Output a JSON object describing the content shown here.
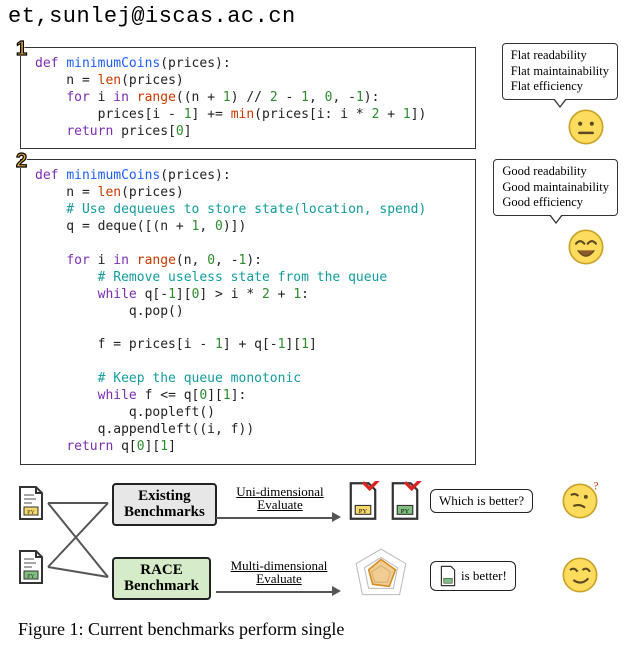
{
  "header": "et,sunlej@iscas.ac.cn",
  "panel1": {
    "badge": "1",
    "line1_def": "def ",
    "line1_fn": "minimumCoins",
    "line1_rest": "(prices):",
    "line2_a": "    n = ",
    "line2_b": "len",
    "line2_c": "(prices)",
    "line3_a": "    ",
    "line3_for": "for ",
    "line3_b": "i ",
    "line3_in": "in ",
    "line3_rng": "range",
    "line3_c": "((n + ",
    "line3_n1": "1",
    "line3_d": ") // ",
    "line3_n2": "2",
    "line3_e": " - ",
    "line3_n3": "1",
    "line3_f": ", ",
    "line3_n4": "0",
    "line3_g": ", -",
    "line3_n5": "1",
    "line3_h": "):",
    "line4_a": "        prices[i - ",
    "line4_n1": "1",
    "line4_b": "] += ",
    "line4_min": "min",
    "line4_c": "(prices[i: i * ",
    "line4_n2": "2",
    "line4_d": " + ",
    "line4_n3": "1",
    "line4_e": "])",
    "line5_a": "    ",
    "line5_ret": "return ",
    "line5_b": "prices[",
    "line5_n": "0",
    "line5_c": "]"
  },
  "bubble1": {
    "l1": "Flat readability",
    "l2": "Flat maintainability",
    "l3": "Flat efficiency"
  },
  "panel2": {
    "badge": "2",
    "l1_def": "def ",
    "l1_fn": "minimumCoins",
    "l1_rest": "(prices):",
    "l2a": "    n = ",
    "l2b": "len",
    "l2c": "(prices)",
    "l3": "    # Use dequeues to store state(location, spend)",
    "l4a": "    q = deque([(n + ",
    "l4n1": "1",
    "l4b": ", ",
    "l4n2": "0",
    "l4c": ")])",
    "blank1": " ",
    "l5a": "    ",
    "l5for": "for ",
    "l5b": "i ",
    "l5in": "in ",
    "l5rng": "range",
    "l5c": "(n, ",
    "l5n1": "0",
    "l5d": ", -",
    "l5n2": "1",
    "l5e": "):",
    "l6": "        # Remove useless state from the queue",
    "l7a": "        ",
    "l7w": "while ",
    "l7b": "q[-",
    "l7n1": "1",
    "l7c": "][",
    "l7n2": "0",
    "l7d": "] > i * ",
    "l7n3": "2",
    "l7e": " + ",
    "l7n4": "1",
    "l7f": ":",
    "l8": "            q.pop()",
    "blank2": " ",
    "l9a": "        f = prices[i - ",
    "l9n1": "1",
    "l9b": "] + q[-",
    "l9n2": "1",
    "l9c": "][",
    "l9n3": "1",
    "l9d": "]",
    "blank3": " ",
    "l10": "        # Keep the queue monotonic",
    "l11a": "        ",
    "l11w": "while ",
    "l11b": "f <= q[",
    "l11n1": "0",
    "l11c": "][",
    "l11n2": "1",
    "l11d": "]:",
    "l12": "            q.popleft()",
    "l13": "        q.appendleft((i, f))",
    "l14a": "    ",
    "l14ret": "return ",
    "l14b": "q[",
    "l14n1": "0",
    "l14c": "][",
    "l14n2": "1",
    "l14d": "]"
  },
  "bubble2": {
    "l1": "Good readability",
    "l2": "Good maintainability",
    "l3": "Good efficiency"
  },
  "diagram": {
    "existing_l1": "Existing",
    "existing_l2": "Benchmarks",
    "race_l1": "RACE",
    "race_l2": "Benchmark",
    "uni_l1": "Uni-dimensional",
    "uni_l2": "Evaluate",
    "multi_l1": "Multi-dimensional",
    "multi_l2": "Evaluate",
    "q_which": "Which is better?",
    "a_better": " is better!"
  },
  "caption": "Figure 1:  Current benchmarks perform single"
}
